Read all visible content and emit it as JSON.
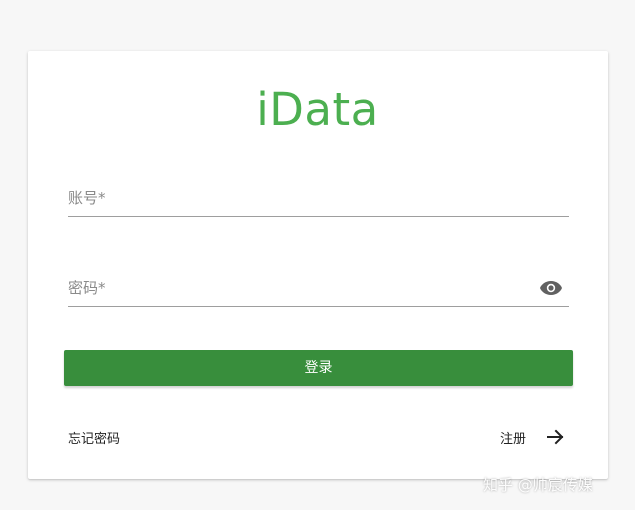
{
  "app": {
    "logo_text": "iData",
    "accent_color": "#4caf50",
    "button_color": "#388e3c"
  },
  "form": {
    "account_placeholder": "账号*",
    "account_value": "",
    "password_placeholder": "密码*",
    "password_value": "",
    "show_password_icon": "eye-icon",
    "login_label": "登录"
  },
  "footer": {
    "forgot_label": "忘记密码",
    "register_label": "注册",
    "register_icon": "arrow-right-icon"
  },
  "watermark": "知乎 @帅宸传媒"
}
